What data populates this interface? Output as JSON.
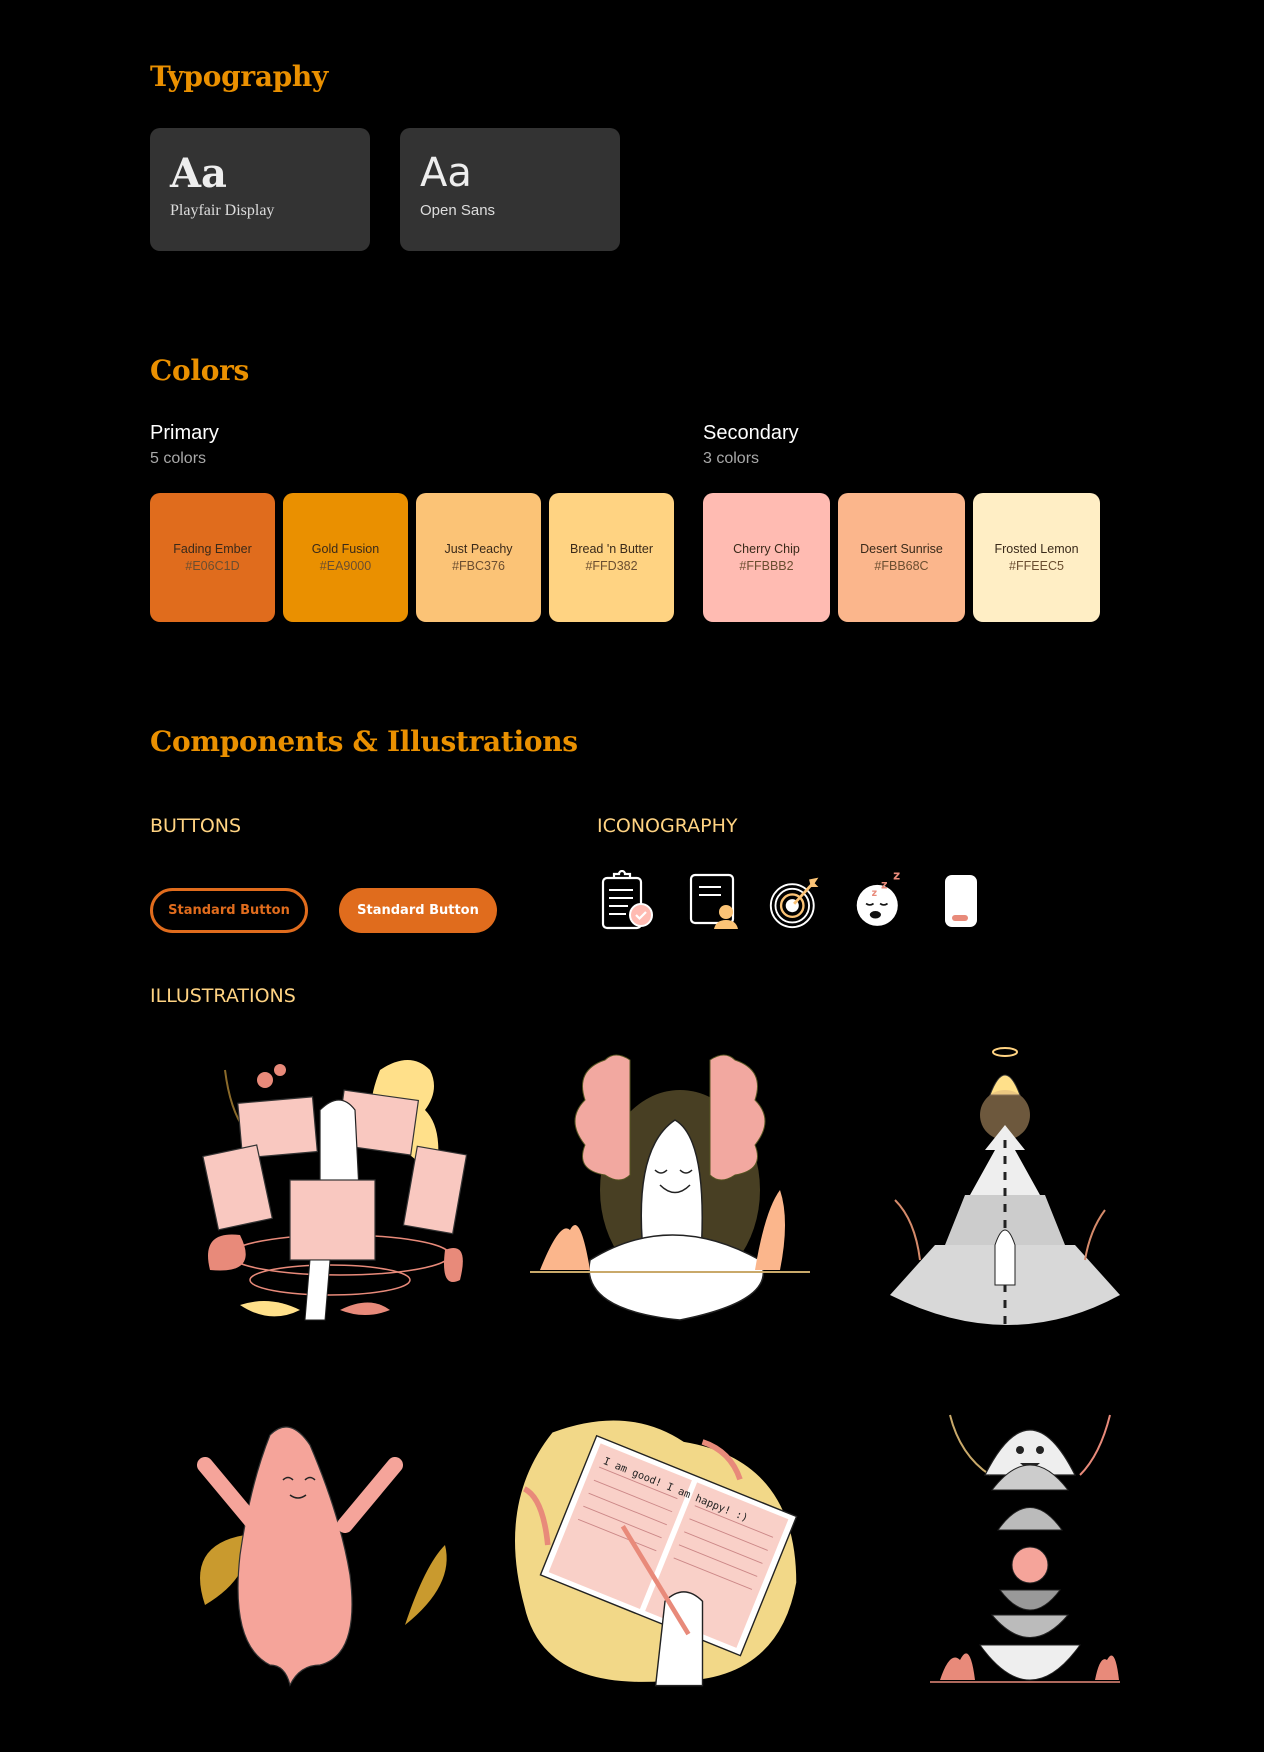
{
  "typography": {
    "heading": "Typography",
    "fonts": [
      {
        "sample": "Aa",
        "name": "Playfair Display"
      },
      {
        "sample": "Aa",
        "name": "Open Sans"
      }
    ]
  },
  "colors": {
    "heading": "Colors",
    "primary": {
      "title": "Primary",
      "count": "5 colors",
      "swatches": [
        {
          "name": "Fading Ember",
          "hex": "#E06C1D"
        },
        {
          "name": "Gold Fusion",
          "hex": "#EA9000"
        },
        {
          "name": "Just Peachy",
          "hex": "#FBC376"
        },
        {
          "name": "Bread 'n Butter",
          "hex": "#FFD382"
        }
      ]
    },
    "secondary": {
      "title": "Secondary",
      "count": "3 colors",
      "swatches": [
        {
          "name": "Cherry Chip",
          "hex": "#FFBBB2"
        },
        {
          "name": "Desert Sunrise",
          "hex": "#FBB68C"
        },
        {
          "name": "Frosted Lemon",
          "hex": "#FFEEC5"
        }
      ]
    }
  },
  "components": {
    "heading": "Components & Illustrations",
    "buttons": {
      "title": "BUTTONS",
      "outline_label": "Standard Button",
      "filled_label": "Standard Button"
    },
    "iconography": {
      "title": "ICONOGRAPHY",
      "icons": [
        "clipboard-check-icon",
        "document-user-icon",
        "target-arrow-icon",
        "sleepy-face-icon",
        "phone-icon"
      ]
    },
    "illustrations": {
      "title": "ILLUSTRATIONS",
      "items": [
        {
          "name": "memories-carousel"
        },
        {
          "name": "meditating-mind"
        },
        {
          "name": "path-to-self"
        },
        {
          "name": "joyful-jump"
        },
        {
          "name": "journal-writing",
          "text": "I am good! I am happy! :)"
        },
        {
          "name": "nested-shells"
        }
      ]
    }
  }
}
